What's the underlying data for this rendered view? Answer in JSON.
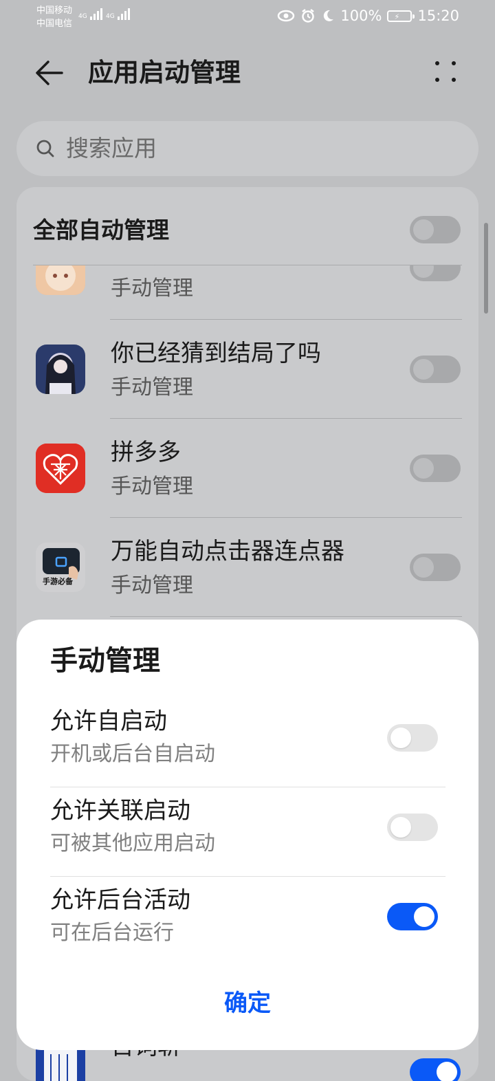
{
  "status_bar": {
    "carrier1": "中国移动",
    "carrier2": "中国电信",
    "net1": "4G",
    "net2": "4G",
    "battery": "100%",
    "time": "15:20"
  },
  "header": {
    "title": "应用启动管理"
  },
  "search": {
    "placeholder": "搜索应用"
  },
  "list": {
    "all_label": "全部自动管理",
    "items": [
      {
        "name": "",
        "sub": "手动管理",
        "icon": "cartoon-app-icon"
      },
      {
        "name": "你已经猜到结局了吗",
        "sub": "手动管理",
        "icon": "anime-girl-app-icon"
      },
      {
        "name": "拼多多",
        "sub": "手动管理",
        "icon": "pinduoduo-app-icon"
      },
      {
        "name": "万能自动点击器连点器",
        "sub": "手动管理",
        "icon": "auto-clicker-app-icon",
        "icon_text": "手游必备"
      }
    ],
    "partial_item_name": "百词斩"
  },
  "sheet": {
    "title": "手动管理",
    "options": [
      {
        "title": "允许自启动",
        "sub": "开机或后台自启动",
        "enabled": false
      },
      {
        "title": "允许关联启动",
        "sub": "可被其他应用启动",
        "enabled": false
      },
      {
        "title": "允许后台活动",
        "sub": "可在后台运行",
        "enabled": true
      }
    ],
    "confirm": "确定"
  },
  "colors": {
    "accent": "#0a59f7",
    "pinduoduo": "#e02e24",
    "scrim": "#bebfc1"
  }
}
